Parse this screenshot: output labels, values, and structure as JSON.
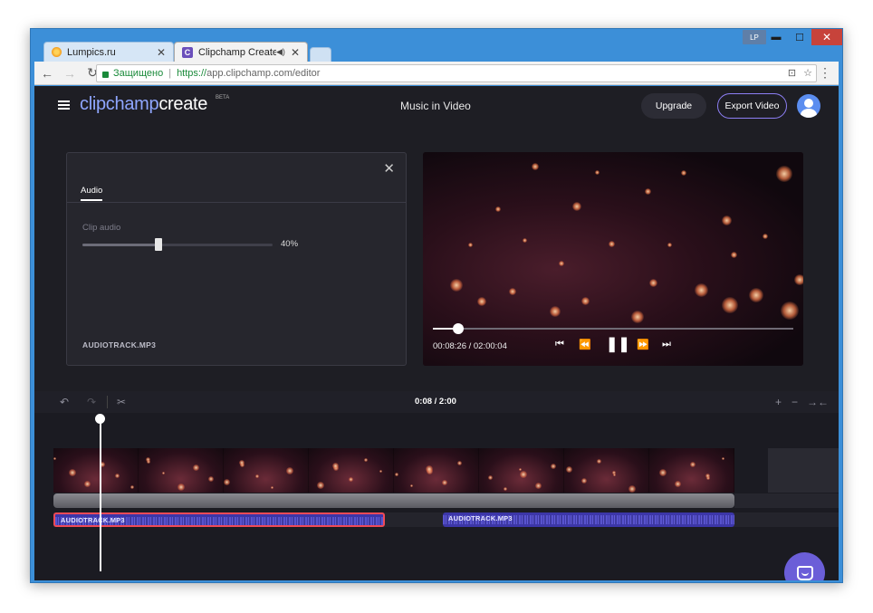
{
  "browser": {
    "tabs": [
      {
        "label": "Lumpics.ru",
        "icon": "orange-favicon-icon",
        "active": false
      },
      {
        "label": "Clipchamp Create",
        "icon": "clipchamp-favicon-icon",
        "active": true,
        "favicon_letter": "C"
      }
    ],
    "profile": "LP",
    "window_controls": {
      "minimize": "▬",
      "maximize": "☐",
      "close": "✕"
    },
    "address": {
      "secure_label": "Защищено",
      "scheme": "https://",
      "url_rest": "app.clipchamp.com/editor"
    }
  },
  "app": {
    "logo_part1": "clipchamp",
    "logo_part2": "create",
    "logo_badge": "BETA",
    "project_title": "Music in Video",
    "upgrade_label": "Upgrade",
    "export_label": "Export Video"
  },
  "audio_panel": {
    "tab_label": "Audio",
    "close_glyph": "✕",
    "slider_label": "Clip audio",
    "volume_percent": 40,
    "volume_text": "40%",
    "file_name": "AUDIOTRACK.MP3"
  },
  "player": {
    "time_text": "00:08:26 / 02:00:04",
    "progress_fraction": 0.07
  },
  "timeline": {
    "current_time": "0:08 / 2:00",
    "audio_clips": [
      {
        "label": "AUDIOTRACK.MP3",
        "selected": true
      },
      {
        "label": "AUDIOTRACK.MP3",
        "selected": false
      }
    ]
  },
  "colors": {
    "accent": "#8d7ff5",
    "logo_accent": "#8fa6ff",
    "selected_clip": "#ef4a57",
    "audio_clip": "#3c36a8",
    "chat_button": "#6b5ed8"
  }
}
